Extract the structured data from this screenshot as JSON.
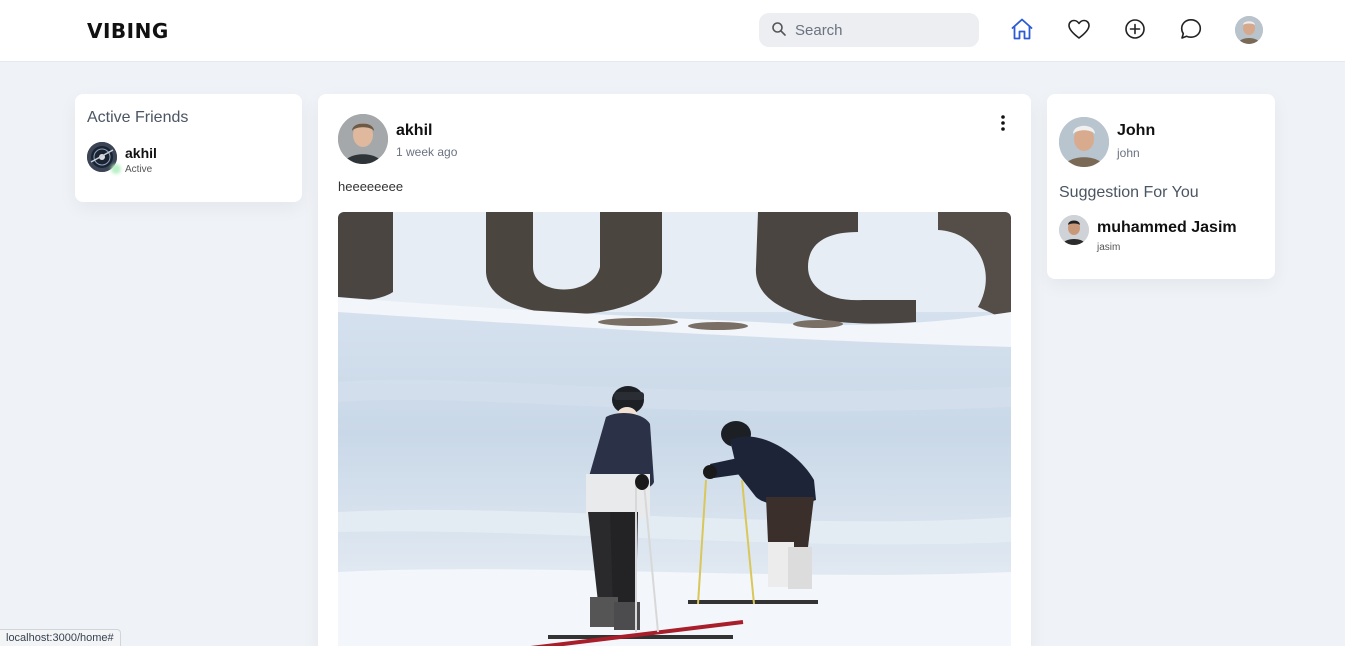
{
  "header": {
    "logo": "VIBING",
    "search": {
      "placeholder": "Search"
    },
    "nav": [
      {
        "icon": "home-icon",
        "active": true
      },
      {
        "icon": "heart-icon",
        "active": false
      },
      {
        "icon": "plus-circle-icon",
        "active": false
      },
      {
        "icon": "chat-icon",
        "active": false
      }
    ],
    "accent_color": "#2d5bd3"
  },
  "active_friends": {
    "title": "Active Friends",
    "friends": [
      {
        "name": "akhil",
        "status": "Active"
      }
    ]
  },
  "post": {
    "author": "akhil",
    "time": "1 week ago",
    "text": "heeeeeeee",
    "image_alt": "two skiers on a snowy slope"
  },
  "profile": {
    "name": "John",
    "handle": "john"
  },
  "suggestions": {
    "title": "Suggestion For You",
    "users": [
      {
        "name": "muhammed Jasim",
        "handle": "jasim"
      }
    ]
  },
  "status_bar": {
    "url": "localhost:3000/home#"
  }
}
